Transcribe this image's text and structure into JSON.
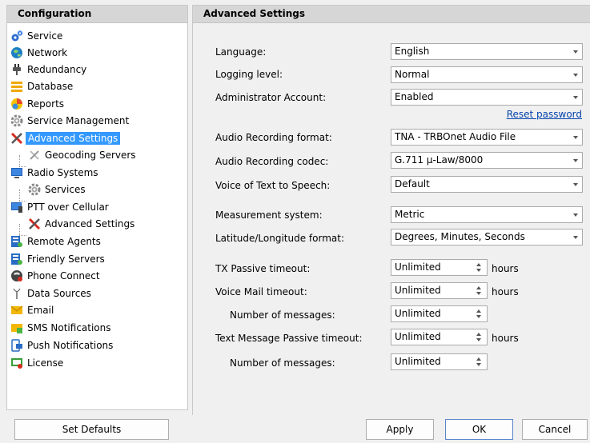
{
  "left_panel": {
    "header": "Configuration",
    "items": [
      {
        "label": "Service",
        "icon": "gears-icon"
      },
      {
        "label": "Network",
        "icon": "globe-icon"
      },
      {
        "label": "Redundancy",
        "icon": "plug-icon"
      },
      {
        "label": "Database",
        "icon": "database-icon"
      },
      {
        "label": "Reports",
        "icon": "reports-icon"
      },
      {
        "label": "Service Management",
        "icon": "gear-icon"
      },
      {
        "label": "Advanced Settings",
        "icon": "tools-icon",
        "selected": true
      },
      {
        "label": "Geocoding Servers",
        "icon": "tools-icon"
      },
      {
        "label": "Radio Systems",
        "icon": "monitor-icon"
      },
      {
        "label": "Services",
        "icon": "gear-icon"
      },
      {
        "label": "PTT over Cellular",
        "icon": "monitor-phone-icon"
      },
      {
        "label": "Advanced Settings",
        "icon": "tools-icon"
      },
      {
        "label": "Remote Agents",
        "icon": "server-icon"
      },
      {
        "label": "Friendly Servers",
        "icon": "server-icon"
      },
      {
        "label": "Phone Connect",
        "icon": "phone-icon"
      },
      {
        "label": "Data Sources",
        "icon": "antenna-icon"
      },
      {
        "label": "Email",
        "icon": "envelope-icon"
      },
      {
        "label": "SMS Notifications",
        "icon": "sms-icon"
      },
      {
        "label": "Push Notifications",
        "icon": "push-icon"
      },
      {
        "label": "License",
        "icon": "license-icon"
      }
    ]
  },
  "right_panel": {
    "header": "Advanced Settings",
    "fields": {
      "language": {
        "label": "Language:",
        "value": "English"
      },
      "logging": {
        "label": "Logging level:",
        "value": "Normal"
      },
      "admin": {
        "label": "Administrator Account:",
        "value": "Enabled"
      },
      "reset_link": "Reset password",
      "audio_format": {
        "label": "Audio Recording format:",
        "value": "TNA - TRBOnet Audio File"
      },
      "audio_codec": {
        "label": "Audio Recording codec:",
        "value": "G.711 µ-Law/8000"
      },
      "tts_voice": {
        "label": "Voice of Text to Speech:",
        "value": "Default"
      },
      "measurement": {
        "label": "Measurement system:",
        "value": "Metric"
      },
      "latlon": {
        "label": "Latitude/Longitude format:",
        "value": "Degrees, Minutes, Seconds"
      },
      "tx_timeout": {
        "label": "TX Passive timeout:",
        "value": "Unlimited",
        "unit": "hours"
      },
      "vm_timeout": {
        "label": "Voice Mail timeout:",
        "value": "Unlimited",
        "unit": "hours"
      },
      "vm_messages": {
        "label": "Number of messages:",
        "value": "Unlimited"
      },
      "txt_timeout": {
        "label": "Text Message Passive timeout:",
        "value": "Unlimited",
        "unit": "hours"
      },
      "txt_messages": {
        "label": "Number of messages:",
        "value": "Unlimited"
      }
    }
  },
  "buttons": {
    "set_defaults": "Set Defaults",
    "apply": "Apply",
    "ok": "OK",
    "cancel": "Cancel"
  }
}
